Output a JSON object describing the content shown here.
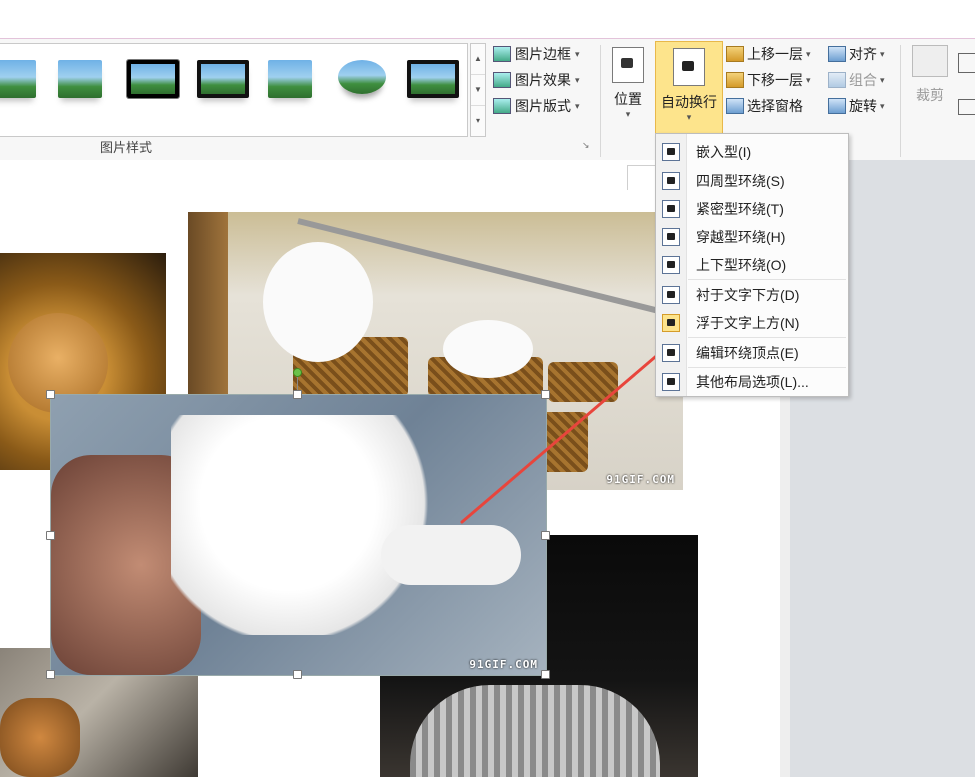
{
  "ribbon": {
    "picture_styles_group_label": "图片样式",
    "style_buttons": [
      {
        "label": "图片边框",
        "icon": "picture-border-icon"
      },
      {
        "label": "图片效果",
        "icon": "picture-effects-icon"
      },
      {
        "label": "图片版式",
        "icon": "picture-layout-icon"
      }
    ],
    "arrange": {
      "position_label": "位置",
      "wrap_text_label": "自动换行",
      "bring_forward_label": "上移一层",
      "send_backward_label": "下移一层",
      "selection_pane_label": "选择窗格",
      "align_label": "对齐",
      "group_label": "组合",
      "rotate_label": "旋转"
    },
    "size": {
      "crop_label": "裁剪"
    }
  },
  "wrap_menu": {
    "items": [
      {
        "label": "嵌入型(I)"
      },
      {
        "label": "四周型环绕(S)"
      },
      {
        "label": "紧密型环绕(T)"
      },
      {
        "label": "穿越型环绕(H)"
      },
      {
        "label": "上下型环绕(O)"
      },
      {
        "label": "衬于文字下方(D)"
      },
      {
        "label": "浮于文字上方(N)"
      },
      {
        "label": "编辑环绕顶点(E)"
      },
      {
        "label": "其他布局选项(L)..."
      }
    ]
  },
  "document": {
    "watermark_1": "91GIF.COM",
    "watermark_2": "91GIF.COM"
  },
  "colors": {
    "active_button_fill": "#fde48c",
    "annotation_arrow": "#e8453c",
    "rotation_handle": "#6cc24a"
  }
}
